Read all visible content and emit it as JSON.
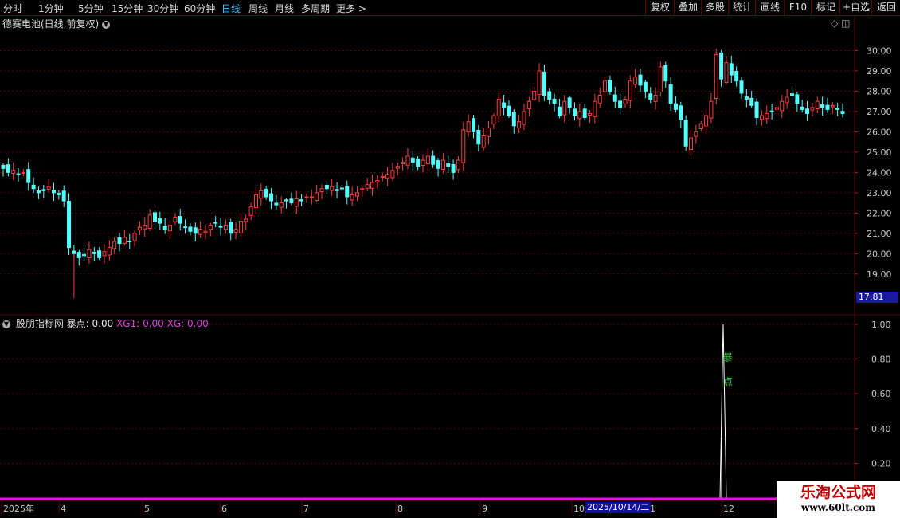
{
  "toolbar": {
    "periods": [
      "分时",
      "1分钟",
      "5分钟",
      "15分钟",
      "30分钟",
      "60分钟",
      "日线",
      "周线",
      "月线",
      "多周期",
      "更多"
    ],
    "active_period": "日线",
    "buttons": [
      "复权",
      "叠加",
      "多股",
      "统计",
      "画线",
      "F10",
      "标记",
      "+自选",
      "返回"
    ]
  },
  "main_title": "德赛电池(日线,前复权)",
  "indicator": {
    "name": "股朋指标网",
    "label1": "暴点: 0.00",
    "label2": "XG1: 0.00",
    "label3": "XG: 0.00",
    "text_upper": "暴",
    "text_lower": "点"
  },
  "price_tag": "17.81",
  "date_tag": "2025/10/14/二",
  "x_labels": [
    "2025年",
    "4",
    "5",
    "6",
    "7",
    "8",
    "9",
    "10",
    "1",
    "12"
  ],
  "watermark": {
    "line1": "乐淘公式网",
    "line2": "www.60lt.com"
  },
  "colors": {
    "up": "#ff3c3c",
    "down": "#54ffff",
    "grid": "#5a0000",
    "magenta": "#ff00ff"
  },
  "chart_data": {
    "type": "candlestick",
    "price_axis": {
      "ticks": [
        30,
        29,
        28,
        27,
        26,
        25,
        24,
        23,
        22,
        21,
        20,
        19
      ],
      "labels": [
        "30.00",
        "29.00",
        "28.00",
        "27.00",
        "26.00",
        "25.00",
        "24.00",
        "23.00",
        "22.00",
        "21.00",
        "20.00",
        "19.00"
      ],
      "range": [
        17.5,
        31.0
      ]
    },
    "indicator_axis": {
      "ticks": [
        1.0,
        0.8,
        0.6,
        0.4,
        0.2
      ],
      "labels": [
        "1.00",
        "0.80",
        "0.60",
        "0.40",
        "0.20"
      ],
      "range": [
        0,
        1.05
      ]
    },
    "closes": [
      24.2,
      24.0,
      24.1,
      23.9,
      24.0,
      23.5,
      23.2,
      23.0,
      23.1,
      23.3,
      23.0,
      22.9,
      22.6,
      20.3,
      20.0,
      19.8,
      19.9,
      20.2,
      20.0,
      19.8,
      20.1,
      20.3,
      20.6,
      20.5,
      20.8,
      20.6,
      21.0,
      21.3,
      21.4,
      21.9,
      21.6,
      21.5,
      21.2,
      21.4,
      21.8,
      21.5,
      21.3,
      21.1,
      21.0,
      21.2,
      21.1,
      21.4,
      21.5,
      21.3,
      21.4,
      21.0,
      21.2,
      21.6,
      21.7,
      22.3,
      22.9,
      23.1,
      22.8,
      22.6,
      22.4,
      22.5,
      22.6,
      22.5,
      22.7,
      22.6,
      22.8,
      22.8,
      23.0,
      23.2,
      23.2,
      23.3,
      23.1,
      23.2,
      22.8,
      22.9,
      23.0,
      23.2,
      23.4,
      23.5,
      23.6,
      23.8,
      23.9,
      24.1,
      24.3,
      24.5,
      24.8,
      24.5,
      24.3,
      24.6,
      24.8,
      24.4,
      24.2,
      24.6,
      24.3,
      24.0,
      24.6,
      26.1,
      26.5,
      26.0,
      25.4,
      25.8,
      26.2,
      26.8,
      27.6,
      27.2,
      26.8,
      26.3,
      26.5,
      27.0,
      27.5,
      28.0,
      29.0,
      27.8,
      27.6,
      27.4,
      26.8,
      27.5,
      27.2,
      26.8,
      27.0,
      26.7,
      26.9,
      27.5,
      27.8,
      28.5,
      28.0,
      27.5,
      27.2,
      27.6,
      28.5,
      28.7,
      28.3,
      28.0,
      27.6,
      27.8,
      29.2,
      28.5,
      27.4,
      27.1,
      26.6,
      25.3,
      25.7,
      26.0,
      26.4,
      26.8,
      27.5,
      29.8,
      28.6,
      29.4,
      28.8,
      28.5,
      27.9,
      27.6,
      27.3,
      26.7,
      26.8,
      26.9,
      27.0,
      27.2,
      27.5,
      27.7,
      27.8,
      27.4,
      27.1,
      26.9,
      27.2,
      27.5,
      27.2,
      27.1,
      27.3,
      27.1,
      26.9
    ]
  },
  "signal": {
    "peak": 1.0,
    "base": 0.2
  }
}
